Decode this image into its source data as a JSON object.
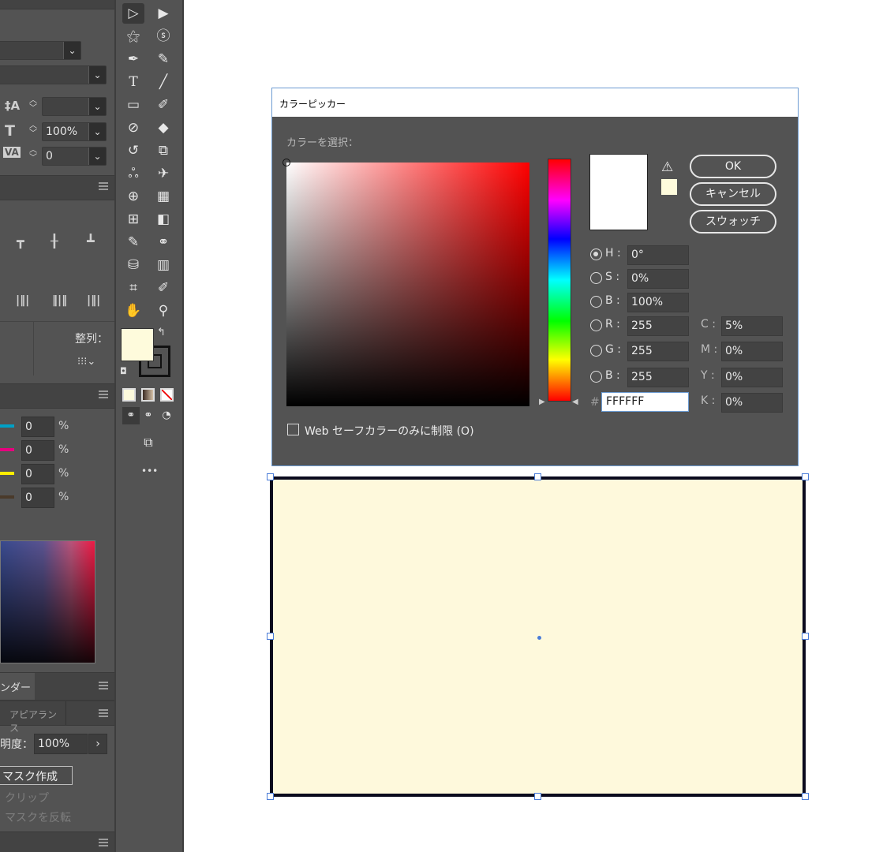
{
  "left_panel": {
    "character": {
      "tracking_value": "",
      "scale_value": "100%",
      "kerning_value": "0"
    },
    "align": {
      "distribute_label": "整列："
    },
    "color": {
      "rows": [
        {
          "color": "#00a0c6",
          "value": "0",
          "unit": "%"
        },
        {
          "color": "#e6007e",
          "value": "0",
          "unit": "%"
        },
        {
          "color": "#ffed00",
          "value": "0",
          "unit": "%"
        },
        {
          "color": "#4a3a2a",
          "value": "0",
          "unit": "%"
        }
      ]
    },
    "tabs": {
      "render_tab": "ンダー",
      "appearance_tab": "アピアランス"
    },
    "transparency": {
      "opacity_label": "明度：",
      "opacity_value": "100%",
      "make_mask_button": "マスク作成",
      "clip_label": "クリップ",
      "invert_mask_label": "マスクを反転"
    }
  },
  "toolbar": {
    "fill_color": "#fefbdc",
    "more_tools": "•••"
  },
  "color_picker": {
    "title": "カラーピッカー",
    "select_color_label": "カラーを選択：",
    "ok_button": "OK",
    "cancel_button": "キャンセル",
    "swatches_button": "スウォッチ",
    "hsb_rgb": [
      {
        "name": "H",
        "value": "0°",
        "selected": true
      },
      {
        "name": "S",
        "value": "0%",
        "selected": false
      },
      {
        "name": "B",
        "value": "100%",
        "selected": false
      },
      {
        "name": "R",
        "value": "255",
        "selected": false
      },
      {
        "name": "G",
        "value": "255",
        "selected": false
      },
      {
        "name": "B",
        "value": "255",
        "selected": false
      }
    ],
    "cmyk": [
      {
        "name": "C",
        "value": "5%"
      },
      {
        "name": "M",
        "value": "0%"
      },
      {
        "name": "Y",
        "value": "0%"
      },
      {
        "name": "K",
        "value": "0%"
      }
    ],
    "hex_prefix": "#",
    "hex_value": "FFFFFF",
    "web_safe_label": "Web セーフカラーのみに制限 (O)",
    "new_color": "#ffffff",
    "gamut_swatch": "#fefbdc"
  },
  "canvas": {
    "rect_fill": "#fef9dc"
  }
}
